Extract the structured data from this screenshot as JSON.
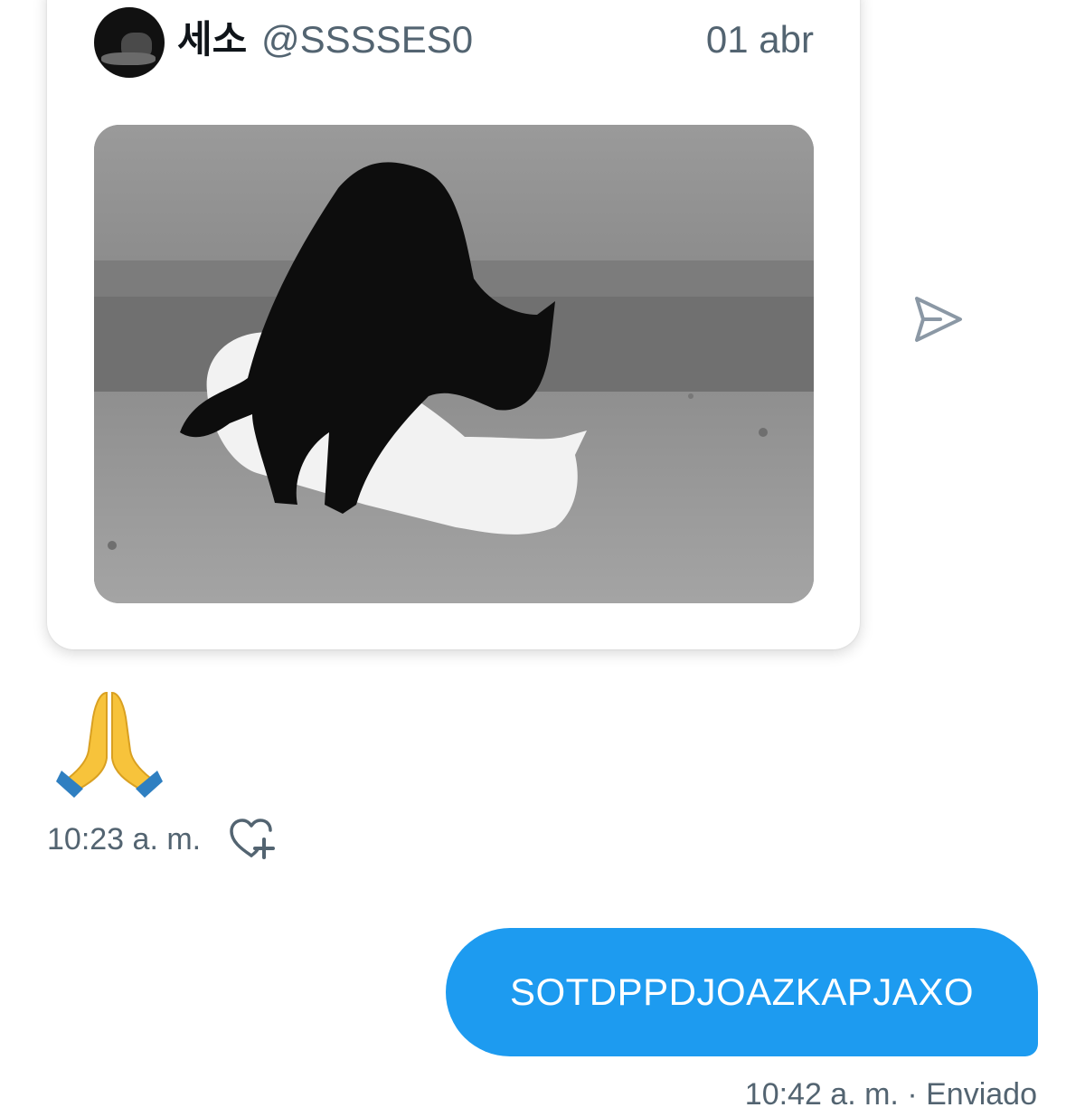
{
  "shared_tweet": {
    "author_name": "세소",
    "author_handle": "@SSSSES0",
    "date": "01 abr",
    "media_description_icon": "cats-photo"
  },
  "received_message": {
    "emoji": "🙏",
    "emoji_icon": "folded-hands-icon",
    "timestamp": "10:23 a. m."
  },
  "sent_message": {
    "text": "SOTDPPDJOAZKAPJAXO",
    "timestamp": "10:42 a. m.",
    "separator": "·",
    "status": "Enviado"
  },
  "colors": {
    "accent": "#1d9bf0",
    "secondary_text": "#536471",
    "icon_gray": "#8b98a5",
    "emoji_yellow": "#f7c33b",
    "emoji_blue": "#2f7fc1"
  }
}
